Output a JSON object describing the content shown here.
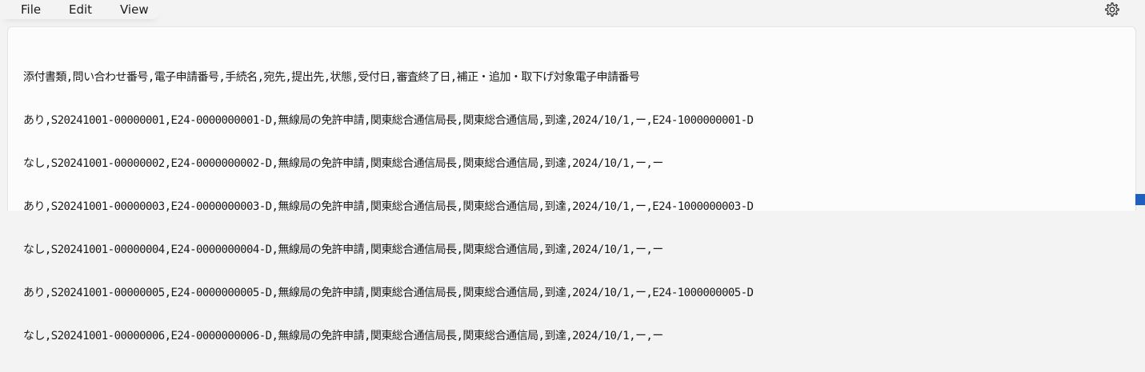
{
  "menu": {
    "file_label": "File",
    "edit_label": "Edit",
    "view_label": "View"
  },
  "icons": {
    "settings": "gear-icon"
  },
  "colors": {
    "accent": "#1f5fbf",
    "editor_background": "#fcfcfc",
    "chrome_background": "#f3f3f3",
    "text": "#1a1a1a"
  },
  "document": {
    "lines": [
      "添付書類,問い合わせ番号,電子申請番号,手続名,宛先,提出先,状態,受付日,審査終了日,補正・追加・取下げ対象電子申請番号",
      "あり,S20241001-00000001,E24-0000000001-D,無線局の免許申請,関東総合通信局長,関東総合通信局,到達,2024/10/1,ー,E24-1000000001-D",
      "なし,S20241001-00000002,E24-0000000002-D,無線局の免許申請,関東総合通信局長,関東総合通信局,到達,2024/10/1,ー,ー",
      "あり,S20241001-00000003,E24-0000000003-D,無線局の免許申請,関東総合通信局長,関東総合通信局,到達,2024/10/1,ー,E24-1000000003-D",
      "なし,S20241001-00000004,E24-0000000004-D,無線局の免許申請,関東総合通信局長,関東総合通信局,到達,2024/10/1,ー,ー",
      "あり,S20241001-00000005,E24-0000000005-D,無線局の免許申請,関東総合通信局長,関東総合通信局,到達,2024/10/1,ー,E24-1000000005-D",
      "なし,S20241001-00000006,E24-0000000006-D,無線局の免許申請,関東総合通信局長,関東総合通信局,到達,2024/10/1,ー,ー"
    ]
  }
}
